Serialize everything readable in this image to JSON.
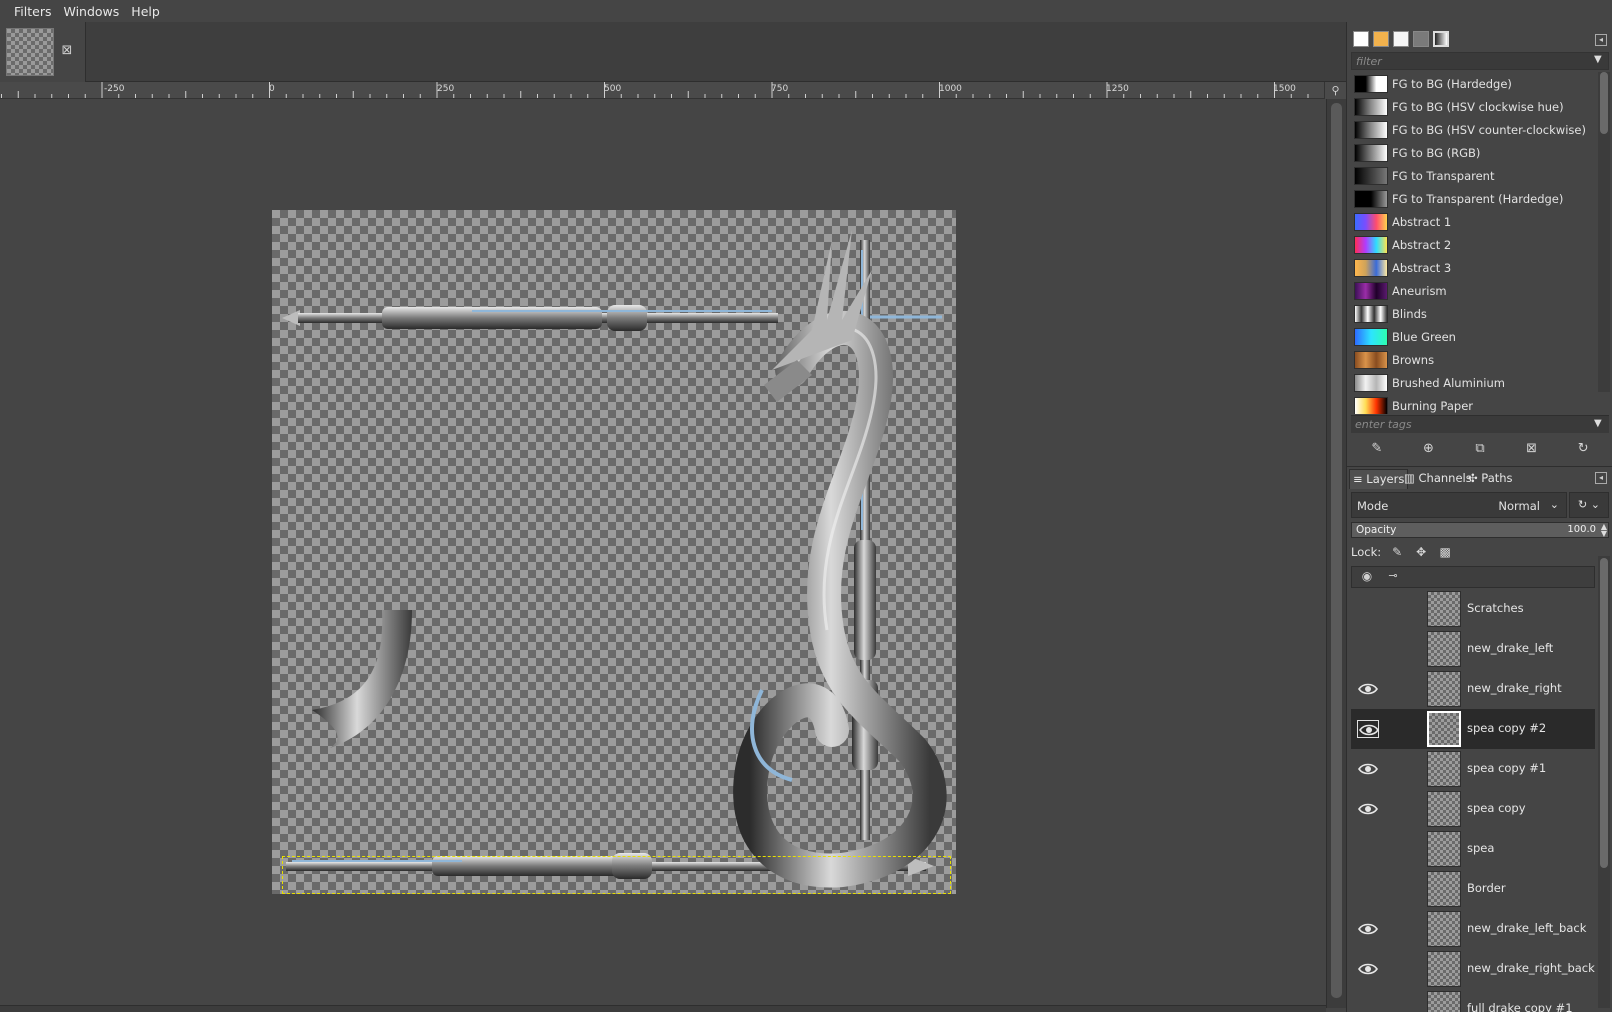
{
  "menubar": {
    "items": [
      "Filters",
      "Windows",
      "Help"
    ]
  },
  "image_tab": {
    "close_glyph": "⊠",
    "close_icon": "close-icon"
  },
  "ruler": {
    "labels": [
      "-250",
      "0",
      "250",
      "500",
      "750",
      "1000",
      "1250",
      "1500"
    ]
  },
  "gradients": {
    "filter_placeholder": "filter",
    "tags_placeholder": "enter tags",
    "items": [
      {
        "label": "FG to BG (Hardedge)",
        "colors": [
          "#000000",
          "#000000",
          "#ffffff",
          "#ffffff"
        ]
      },
      {
        "label": "FG to BG (HSV clockwise hue)",
        "colors": [
          "#000000",
          "#8a8a8a",
          "#ffffff"
        ]
      },
      {
        "label": "FG to BG (HSV counter-clockwise)",
        "colors": [
          "#000000",
          "#8a8a8a",
          "#ffffff"
        ]
      },
      {
        "label": "FG to BG (RGB)",
        "colors": [
          "#000000",
          "#ffffff"
        ]
      },
      {
        "label": "FG to Transparent",
        "colors": [
          "#000000",
          "#777777"
        ]
      },
      {
        "label": "FG to Transparent (Hardedge)",
        "colors": [
          "#000000",
          "#000000",
          "#999999"
        ]
      },
      {
        "label": "Abstract 1",
        "colors": [
          "#3b6bff",
          "#7a4dff",
          "#ff4d6d",
          "#ffd24d"
        ]
      },
      {
        "label": "Abstract 2",
        "colors": [
          "#ff2d55",
          "#b03cff",
          "#2ddcff",
          "#ffe34d"
        ]
      },
      {
        "label": "Abstract 3",
        "colors": [
          "#ffb64d",
          "#cfa35a",
          "#3a6bd8",
          "#ffe9a0"
        ]
      },
      {
        "label": "Aneurism",
        "colors": [
          "#3b1055",
          "#9a2da8",
          "#20002a",
          "#5a1a6e"
        ]
      },
      {
        "label": "Blinds",
        "colors": [
          "#ffffff",
          "#333333",
          "#ffffff",
          "#333333",
          "#ffffff",
          "#333333"
        ]
      },
      {
        "label": "Blue Green",
        "colors": [
          "#2d6bff",
          "#2de3ff",
          "#2dffb0"
        ]
      },
      {
        "label": "Browns",
        "colors": [
          "#8a4d20",
          "#d9934a",
          "#8a4d20",
          "#d9934a"
        ]
      },
      {
        "label": "Brushed Aluminium",
        "colors": [
          "#8c8c8c",
          "#f2f2f2",
          "#b5b5b5",
          "#ffffff"
        ]
      },
      {
        "label": "Burning Paper",
        "colors": [
          "#ffffff",
          "#ffdd55",
          "#ff3300",
          "#000000"
        ]
      }
    ]
  },
  "gradient_toolbar": {
    "icons": [
      "edit-gradient-icon",
      "new-gradient-icon",
      "duplicate-gradient-icon",
      "delete-gradient-icon",
      "refresh-gradients-icon"
    ],
    "glyphs": [
      "✎",
      "⊕",
      "⧉",
      "⊠",
      "↻"
    ]
  },
  "layers_panel": {
    "tabs": [
      {
        "label": "Layers",
        "icon": "layers-icon",
        "glyph": "≡"
      },
      {
        "label": "Channels",
        "icon": "channels-icon",
        "glyph": "▥"
      },
      {
        "label": "Paths",
        "icon": "paths-icon",
        "glyph": "✣"
      }
    ],
    "mode_label": "Mode",
    "mode_value": "Normal",
    "opacity_label": "Opacity",
    "opacity_value": "100.0",
    "lock_label": "Lock:",
    "layers": [
      {
        "name": "Scratches",
        "visible": false,
        "active": false
      },
      {
        "name": "new_drake_left",
        "visible": false,
        "active": false
      },
      {
        "name": "new_drake_right",
        "visible": true,
        "active": false
      },
      {
        "name": "spea copy #2",
        "visible": true,
        "active": true
      },
      {
        "name": "spea copy #1",
        "visible": true,
        "active": false
      },
      {
        "name": "spea copy",
        "visible": true,
        "active": false
      },
      {
        "name": "spea",
        "visible": false,
        "active": false
      },
      {
        "name": "Border",
        "visible": false,
        "active": false
      },
      {
        "name": "new_drake_left_back",
        "visible": true,
        "active": false
      },
      {
        "name": "new_drake_right_back",
        "visible": true,
        "active": false
      },
      {
        "name": "full drake copy #1",
        "visible": false,
        "active": false
      }
    ]
  }
}
